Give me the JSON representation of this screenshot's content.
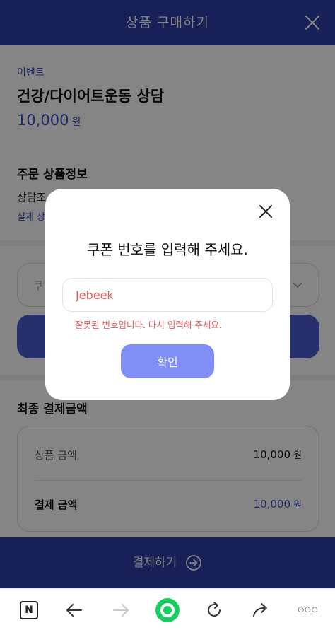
{
  "header": {
    "title": "상품 구매하기",
    "close_icon": "close-icon"
  },
  "product": {
    "event_tag": "이벤트",
    "name": "건강/다이어트운동 상담",
    "price": "10,000",
    "price_unit": "원"
  },
  "order_info": {
    "title": "주문 상품정보",
    "line1": "상담조",
    "line2": "실제 상"
  },
  "coupon": {
    "select_text": "쿠",
    "chevron_icon": "chevron-down-icon"
  },
  "final": {
    "title": "최종 결제금액",
    "rows": [
      {
        "label": "상품 금액",
        "value": "10,000",
        "unit": "원"
      },
      {
        "label": "결제 금액",
        "value": "10,000",
        "unit": "원"
      }
    ]
  },
  "pay_button": {
    "label": "결제하기",
    "icon": "arrow-right-circle-icon"
  },
  "modal": {
    "title": "쿠폰 번호를 입력해 주세요.",
    "input_value": "Jebeek",
    "error": "잘못된 번호입니다. 다시 입력해 주세요.",
    "confirm_label": "확인",
    "close_icon": "close-icon"
  },
  "browser_bar": {
    "items": [
      "naver-home-icon",
      "back-icon",
      "forward-icon",
      "green-dot-icon",
      "refresh-icon",
      "share-icon",
      "more-icon"
    ],
    "home_letter": "N",
    "more_glyph": "○○○"
  },
  "colors": {
    "primary": "#2f3fa9",
    "accent": "#3e4fc3",
    "error": "#e05a5a",
    "confirm": "#7f8ff6",
    "green": "#19ce60"
  }
}
